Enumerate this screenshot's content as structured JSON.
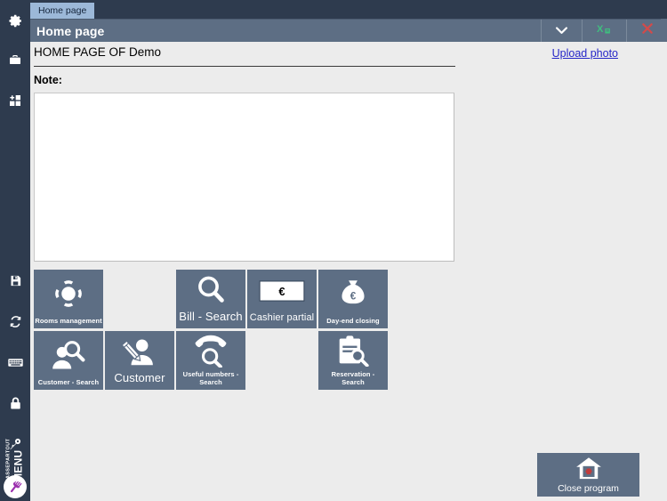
{
  "window": {
    "tab_label": "Home page",
    "title": "Home page",
    "controls": [
      {
        "name": "dropdown-button",
        "icon": "chevron-down-icon",
        "label": ""
      },
      {
        "name": "export-excel-button",
        "icon": "excel-export-icon",
        "label": ""
      },
      {
        "name": "close-window-button",
        "icon": "close-icon",
        "label": ""
      }
    ]
  },
  "sidebar": {
    "items": [
      {
        "name": "settings",
        "icon": "gear-icon"
      },
      {
        "name": "briefcase",
        "icon": "briefcase-icon"
      },
      {
        "name": "add-module",
        "icon": "grid-plus-icon"
      },
      {
        "name": "save",
        "icon": "save-icon"
      },
      {
        "name": "refresh",
        "icon": "refresh-icon"
      },
      {
        "name": "keyboard",
        "icon": "keyboard-icon"
      },
      {
        "name": "lock",
        "icon": "lock-icon"
      },
      {
        "name": "key",
        "icon": "key-icon"
      },
      {
        "name": "exit",
        "icon": "close-x-icon"
      }
    ],
    "brand_small": "PASSEPARTOUT",
    "brand_big": "MENU",
    "brand_logo": "fork-logo-icon"
  },
  "main": {
    "page_title": "HOME PAGE OF Demo",
    "upload_photo_label": "Upload photo",
    "note_label": "Note:",
    "note_value": "",
    "note_placeholder": ""
  },
  "tiles": {
    "rows": [
      [
        {
          "label": "Rooms management",
          "icon": "rooms-management-icon",
          "size": "sm",
          "empty": false
        },
        {
          "label": "",
          "icon": "",
          "size": "sm",
          "empty": true
        },
        {
          "label": "Bill - Search",
          "icon": "magnifier-icon",
          "size": "lg",
          "empty": false
        },
        {
          "label": "Cashier partial",
          "icon": "banknote-euro-icon",
          "size": "md",
          "empty": false
        },
        {
          "label": "Day-end closing",
          "icon": "money-bag-euro-icon",
          "size": "sm",
          "empty": false
        }
      ],
      [
        {
          "label": "Customer - Search",
          "icon": "person-magnifier-icon",
          "size": "sm",
          "empty": false
        },
        {
          "label": "Customer",
          "icon": "person-pencil-icon",
          "size": "lg",
          "empty": false
        },
        {
          "label": "Useful numbers - Search",
          "icon": "phone-magnifier-icon",
          "size": "sm",
          "empty": false
        },
        {
          "label": "",
          "icon": "",
          "size": "sm",
          "empty": true
        },
        {
          "label": "Reservation - Search",
          "icon": "clipboard-magnifier-icon",
          "size": "sm",
          "empty": false
        }
      ]
    ]
  },
  "footer": {
    "close_program_label": "Close program",
    "close_program_icon": "house-close-icon"
  },
  "colors": {
    "sidebar_bg": "#2e3b4e",
    "titlebar_bg": "#5d6e84",
    "tab_bg": "#9cb8d8",
    "tile_bg": "#5d6e84",
    "content_bg": "#ececec",
    "link": "#2727c8",
    "close_red": "#d14b4b",
    "excel_green": "#3fbf7f"
  }
}
